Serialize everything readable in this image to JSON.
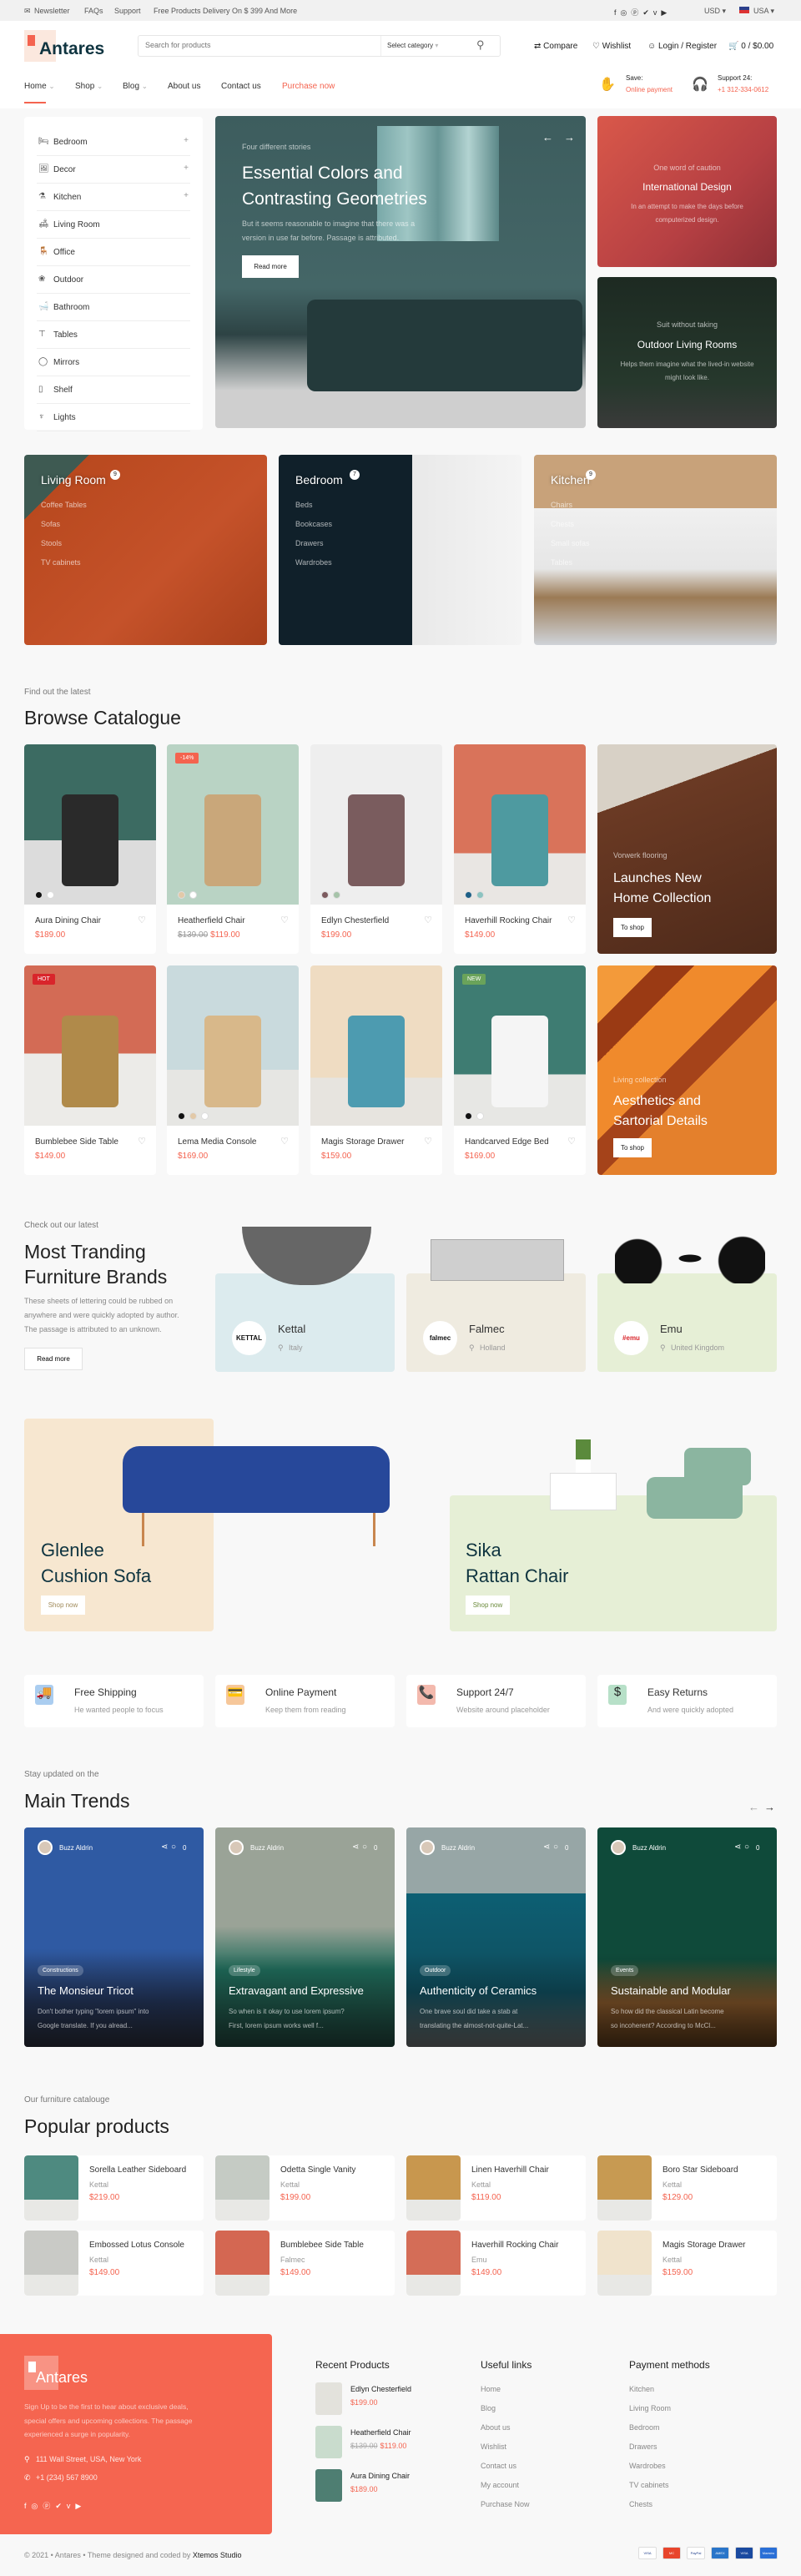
{
  "topbar": {
    "links": [
      "Newsletter",
      "FAQs",
      "Support"
    ],
    "promo": "Free Products Delivery On $ 399 And More",
    "social_icons": [
      "facebook-icon",
      "instagram-icon",
      "pinterest-icon",
      "twitter-icon",
      "vimeo-icon",
      "youtube-icon"
    ],
    "currency": "USD",
    "country": "USA"
  },
  "header": {
    "logo": "Antares",
    "search_placeholder": "Search for products",
    "category_select": "Select category",
    "compare": "Compare",
    "wishlist": "Wishlist",
    "login": "Login / Register",
    "cart": "0 / $0.00"
  },
  "nav": {
    "items": [
      "Home",
      "Shop",
      "Blog",
      "About us",
      "Contact us",
      "Purchase now"
    ],
    "save_label": "Save:",
    "save_value": "Online payment",
    "support_label": "Support 24:",
    "support_value": "+1 312-334-0612"
  },
  "sidebar": {
    "items": [
      {
        "label": "Bedroom",
        "icon": "bed-icon",
        "expandable": true
      },
      {
        "label": "Decor",
        "icon": "picture-icon",
        "expandable": true
      },
      {
        "label": "Kitchen",
        "icon": "kitchen-icon",
        "expandable": true
      },
      {
        "label": "Living Room",
        "icon": "sofa-icon",
        "expandable": false
      },
      {
        "label": "Office",
        "icon": "office-chair-icon",
        "expandable": false
      },
      {
        "label": "Outdoor",
        "icon": "plant-icon",
        "expandable": false
      },
      {
        "label": "Bathroom",
        "icon": "bath-icon",
        "expandable": false
      },
      {
        "label": "Tables",
        "icon": "table-icon",
        "expandable": false
      },
      {
        "label": "Mirrors",
        "icon": "mirror-icon",
        "expandable": false
      },
      {
        "label": "Shelf",
        "icon": "shelf-icon",
        "expandable": false
      },
      {
        "label": "Lights",
        "icon": "chandelier-icon",
        "expandable": false
      }
    ]
  },
  "hero": {
    "eyebrow": "Four different stories",
    "title_line1": "Essential Colors and",
    "title_line2": "Contrasting Geometries",
    "text_line1": "But it seems reasonable to imagine that there was a",
    "text_line2": "version in use far before. Passage is attributed.",
    "button": "Read more"
  },
  "side_banners": [
    {
      "eyebrow": "One word of caution",
      "title": "International Design",
      "text": "In an attempt to make the days before computerized design."
    },
    {
      "eyebrow": "Suit without taking",
      "title": "Outdoor Living Rooms",
      "text": "Helps them imagine what the lived-in website might look like."
    }
  ],
  "category_tiles": [
    {
      "title": "Living Room",
      "count": "9",
      "links": [
        "Coffee Tables",
        "Sofas",
        "Stools",
        "TV cabinets"
      ]
    },
    {
      "title": "Bedroom",
      "count": "7",
      "links": [
        "Beds",
        "Bookcases",
        "Drawers",
        "Wardrobes"
      ]
    },
    {
      "title": "Kitchen",
      "count": "9",
      "links": [
        "Chairs",
        "Chests",
        "Small sofas",
        "Tables"
      ]
    }
  ],
  "catalogue": {
    "label": "Find out the latest",
    "title": "Browse Catalogue",
    "products": [
      {
        "name": "Aura Dining Chair",
        "price": "$189.00",
        "old_price": "",
        "badge": "",
        "swatches": [
          "#111111",
          "#ffffff"
        ]
      },
      {
        "name": "Heatherfield Chair",
        "price": "$119.00",
        "old_price": "$139.00",
        "badge": "-14%",
        "swatches": [
          "#e2c9a8",
          "#ffffff"
        ]
      },
      {
        "name": "Edlyn Chesterfield",
        "price": "$199.00",
        "old_price": "",
        "badge": "",
        "swatches": [
          "#7c5a5e",
          "#a6c3a9"
        ]
      },
      {
        "name": "Haverhill Rocking Chair",
        "price": "$149.00",
        "old_price": "",
        "badge": "",
        "swatches": [
          "#1d5f86",
          "#8cc3c0"
        ]
      },
      {
        "name": "Bumblebee Side Table",
        "price": "$149.00",
        "old_price": "",
        "badge": "HOT",
        "swatches": []
      },
      {
        "name": "Lema Media Console",
        "price": "$169.00",
        "old_price": "",
        "badge": "",
        "swatches": [
          "#111111",
          "#e2c9a8",
          "#ffffff"
        ]
      },
      {
        "name": "Magis Storage Drawer",
        "price": "$159.00",
        "old_price": "",
        "badge": "",
        "swatches": []
      },
      {
        "name": "Handcarved Edge Bed",
        "price": "$169.00",
        "old_price": "",
        "badge": "NEW",
        "swatches": [
          "#111111",
          "#ffffff"
        ]
      }
    ],
    "promos": [
      {
        "eyebrow": "Vorwerk flooring",
        "title_line1": "Launches New",
        "title_line2": "Home Collection",
        "button": "To shop"
      },
      {
        "eyebrow": "Living collection",
        "title_line1": "Aesthetics and",
        "title_line2": "Sartorial Details",
        "button": "To shop"
      }
    ]
  },
  "brands": {
    "label": "Check out our latest",
    "title_line1": "Most Tranding",
    "title_line2": "Furniture Brands",
    "text_line1": "These sheets of lettering could be rubbed on",
    "text_line2": "anywhere and were quickly adopted by author.",
    "text_line3": "The passage is attributed to an unknown.",
    "button": "Read more",
    "items": [
      {
        "name": "Kettal",
        "logo": "KETTAL",
        "location": "Italy",
        "color": "#dcebee"
      },
      {
        "name": "Falmec",
        "logo": "falmec",
        "location": "Holland",
        "color": "#efebe0"
      },
      {
        "name": "Emu",
        "logo": "#emu",
        "location": "United Kingdom",
        "color": "#e6efd6"
      }
    ]
  },
  "feature_banners": [
    {
      "title_line1": "Glenlee",
      "title_line2": "Cushion Sofa",
      "button": "Shop now",
      "color": "#f7e7d0"
    },
    {
      "title_line1": "Sika",
      "title_line2": "Rattan Chair",
      "button": "Shop now",
      "color": "#e6efd6"
    }
  ],
  "features": [
    {
      "title": "Free Shipping",
      "text": "He wanted people to focus",
      "icon": "truck-icon"
    },
    {
      "title": "Online Payment",
      "text": "Keep them from reading",
      "icon": "payment-lock-icon"
    },
    {
      "title": "Support 24/7",
      "text": "Website around placeholder",
      "icon": "phone-support-icon"
    },
    {
      "title": "Easy Returns",
      "text": "And were quickly adopted",
      "icon": "dollar-return-icon"
    }
  ],
  "trends": {
    "label": "Stay updated on the",
    "title": "Main Trends",
    "posts": [
      {
        "author": "Buzz Aldrin",
        "comments": "0",
        "tag": "Constructions",
        "title": "The Monsieur Tricot",
        "text_line1": "Don't bother typing \"lorem ipsum\" into",
        "text_line2": "Google translate. If you alread..."
      },
      {
        "author": "Buzz Aldrin",
        "comments": "0",
        "tag": "Lifestyle",
        "title": "Extravagant and Expressive",
        "text_line1": "So when is it okay to use lorem ipsum?",
        "text_line2": "First, lorem ipsum works well f..."
      },
      {
        "author": "Buzz Aldrin",
        "comments": "0",
        "tag": "Outdoor",
        "title": "Authenticity of Ceramics",
        "text_line1": "One brave soul did take a stab at",
        "text_line2": "translating the almost-not-quite-Lat..."
      },
      {
        "author": "Buzz Aldrin",
        "comments": "0",
        "tag": "Events",
        "title": "Sustainable and Modular",
        "text_line1": "So how did the classical Latin become",
        "text_line2": "so incoherent? According to McCl..."
      }
    ]
  },
  "popular": {
    "label": "Our furniture catalouge",
    "title": "Popular products",
    "products": [
      {
        "name": "Sorella Leather Sideboard",
        "brand": "Kettal",
        "price": "$219.00"
      },
      {
        "name": "Odetta Single Vanity",
        "brand": "Kettal",
        "price": "$199.00"
      },
      {
        "name": "Linen Haverhill Chair",
        "brand": "Kettal",
        "price": "$119.00"
      },
      {
        "name": "Boro Star Sideboard",
        "brand": "Kettal",
        "price": "$129.00"
      },
      {
        "name": "Embossed Lotus Console",
        "brand": "Kettal",
        "price": "$149.00"
      },
      {
        "name": "Bumblebee Side Table",
        "brand": "Falmec",
        "price": "$149.00"
      },
      {
        "name": "Haverhill Rocking Chair",
        "brand": "Emu",
        "price": "$149.00"
      },
      {
        "name": "Magis Storage Drawer",
        "brand": "Kettal",
        "price": "$159.00"
      }
    ]
  },
  "footer": {
    "logo": "Antares",
    "text_line1": "Sign Up to be the first to hear about exclusive deals,",
    "text_line2": "special offers and upcoming collections. The passage",
    "text_line3": "experienced a surge in popularity.",
    "address": "111 Wall Street, USA, New York",
    "phone": "+1 (234) 567 8900",
    "recent_title": "Recent Products",
    "recent": [
      {
        "name": "Edlyn Chesterfield",
        "price": "$199.00",
        "old_price": ""
      },
      {
        "name": "Heatherfield Chair",
        "price": "$119.00",
        "old_price": "$139.00"
      },
      {
        "name": "Aura Dining Chair",
        "price": "$189.00",
        "old_price": ""
      }
    ],
    "useful_title": "Useful links",
    "useful": [
      "Home",
      "Blog",
      "About us",
      "Wishlist",
      "Contact us",
      "My account",
      "Purchase Now"
    ],
    "payment_title": "Payment methods",
    "payment": [
      "Kitchen",
      "Living Room",
      "Bedroom",
      "Drawers",
      "Wardrobes",
      "TV cabinets",
      "Chests"
    ],
    "copyright": "© 2021 • Antares • Theme designed and coded by",
    "copyright_brand": "Xtemos Studio",
    "cards": [
      "VISA",
      "MC",
      "PayPal",
      "AMEX",
      "VISA Electron",
      "Maestro"
    ]
  },
  "colors": {
    "accent": "#f4634f",
    "dark": "#0f3440",
    "hot": "#d9252b",
    "new": "#6aa35a"
  }
}
